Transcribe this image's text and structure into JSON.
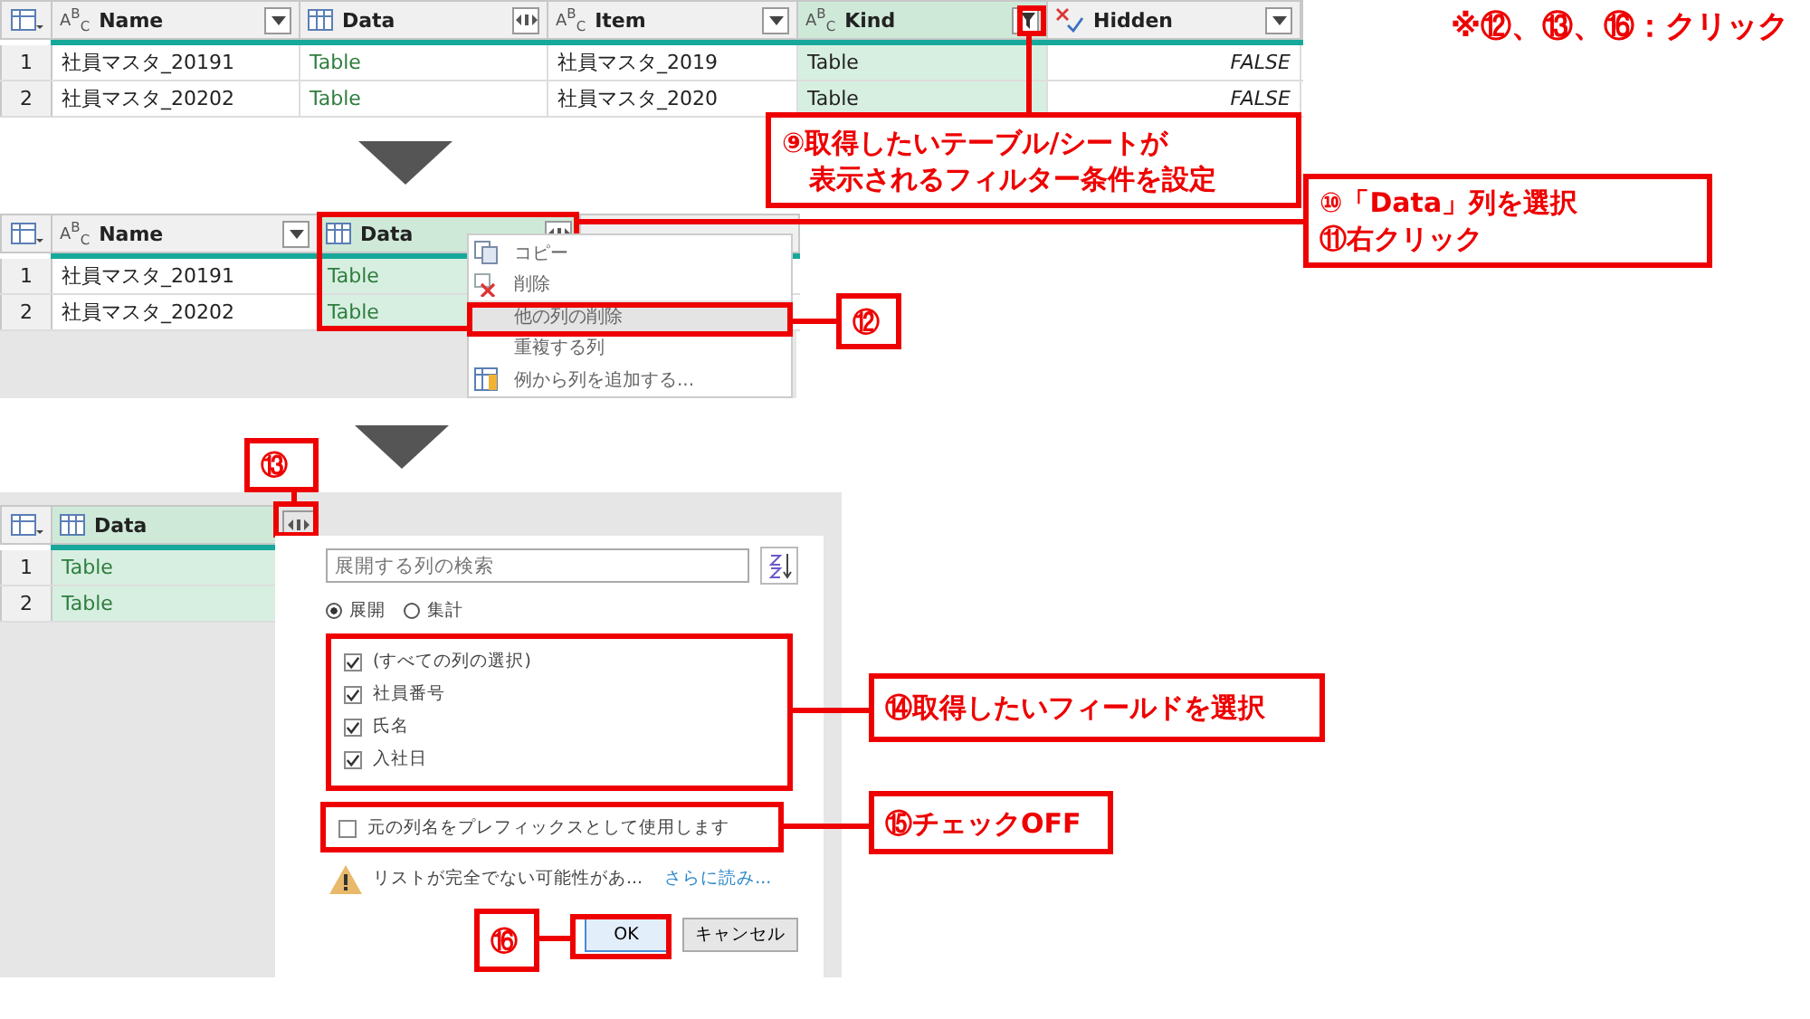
{
  "note": "※⑫、⑬、⑯：クリック",
  "table1": {
    "columns": [
      {
        "kind": "text",
        "type_label": "A$^{B}$$_{C}$",
        "name": "Name",
        "selected": false
      },
      {
        "kind": "table",
        "name": "Data",
        "selected": false
      },
      {
        "kind": "text",
        "type_label": "A$^{B}$$_{C}$",
        "name": "Item",
        "selected": false
      },
      {
        "kind": "text",
        "type_label": "A$^{B}$$_{C}$",
        "name": "Kind",
        "selected": true
      },
      {
        "kind": "logical",
        "name": "Hidden",
        "selected": false
      }
    ],
    "rows": [
      {
        "number": "1",
        "cells": [
          "社員マスタ_20191",
          "Table",
          "社員マスタ_2019",
          "Table",
          "FALSE"
        ]
      },
      {
        "number": "2",
        "cells": [
          "社員マスタ_20202",
          "Table",
          "社員マスタ_2020",
          "Table",
          "FALSE"
        ]
      }
    ]
  },
  "table2": {
    "columns": [
      {
        "kind": "text",
        "type_label": "A$^{B}$$_{C}$",
        "name": "Name",
        "selected": false
      },
      {
        "kind": "table",
        "name": "Data",
        "selected": true
      }
    ],
    "rows": [
      {
        "number": "1",
        "cells": [
          "社員マスタ_20191",
          "Table"
        ]
      },
      {
        "number": "2",
        "cells": [
          "社員マスタ_20202",
          "Table"
        ]
      }
    ]
  },
  "context_menu": {
    "items": [
      {
        "label": "コピー",
        "selected": false
      },
      {
        "label": "削除",
        "selected": false
      },
      {
        "label": "他の列の削除",
        "selected": true
      },
      {
        "label": "重複する列",
        "selected": false
      },
      {
        "label": "例から列を追加する...",
        "selected": false
      }
    ]
  },
  "table3": {
    "columns": [
      {
        "kind": "table",
        "name": "Data",
        "selected": true
      }
    ],
    "rows": [
      {
        "number": "1",
        "cells": [
          "Table"
        ]
      },
      {
        "number": "2",
        "cells": [
          "Table"
        ]
      }
    ]
  },
  "expand_dialog": {
    "search": {
      "placeholder": "展開する列の検索"
    },
    "modes": [
      {
        "label": "展開",
        "selected": true
      },
      {
        "label": "集計",
        "selected": false
      }
    ],
    "columns": [
      {
        "label": "(すべての列の選択)",
        "checked": true
      },
      {
        "label": "社員番号",
        "checked": true
      },
      {
        "label": "氏名",
        "checked": true
      },
      {
        "label": "入社日",
        "checked": true
      }
    ],
    "prefix_option": {
      "label": "元の列名をプレフィックスとして使用します",
      "checked": false
    },
    "warning": {
      "text": "リストが完全でない可能性があ...",
      "link": "さらに読み..."
    },
    "buttons": [
      {
        "label": "OK",
        "kind": "primary"
      },
      {
        "label": "キャンセル",
        "kind": "secondary"
      }
    ]
  },
  "callouts": [
    {
      "lines": [
        "⑨取得したいテーブル/シートが",
        "　表示されるフィルター条件を設定"
      ]
    },
    {
      "lines": [
        "⑩「Data」列を選択",
        "⑪右クリック"
      ]
    },
    {
      "lines": [
        "⑫"
      ]
    },
    {
      "lines": [
        "⑬"
      ]
    },
    {
      "lines": [
        "⑭取得したいフィールドを選択"
      ]
    },
    {
      "lines": [
        "⑮チェックOFF"
      ]
    },
    {
      "lines": [
        "⑯"
      ]
    }
  ]
}
